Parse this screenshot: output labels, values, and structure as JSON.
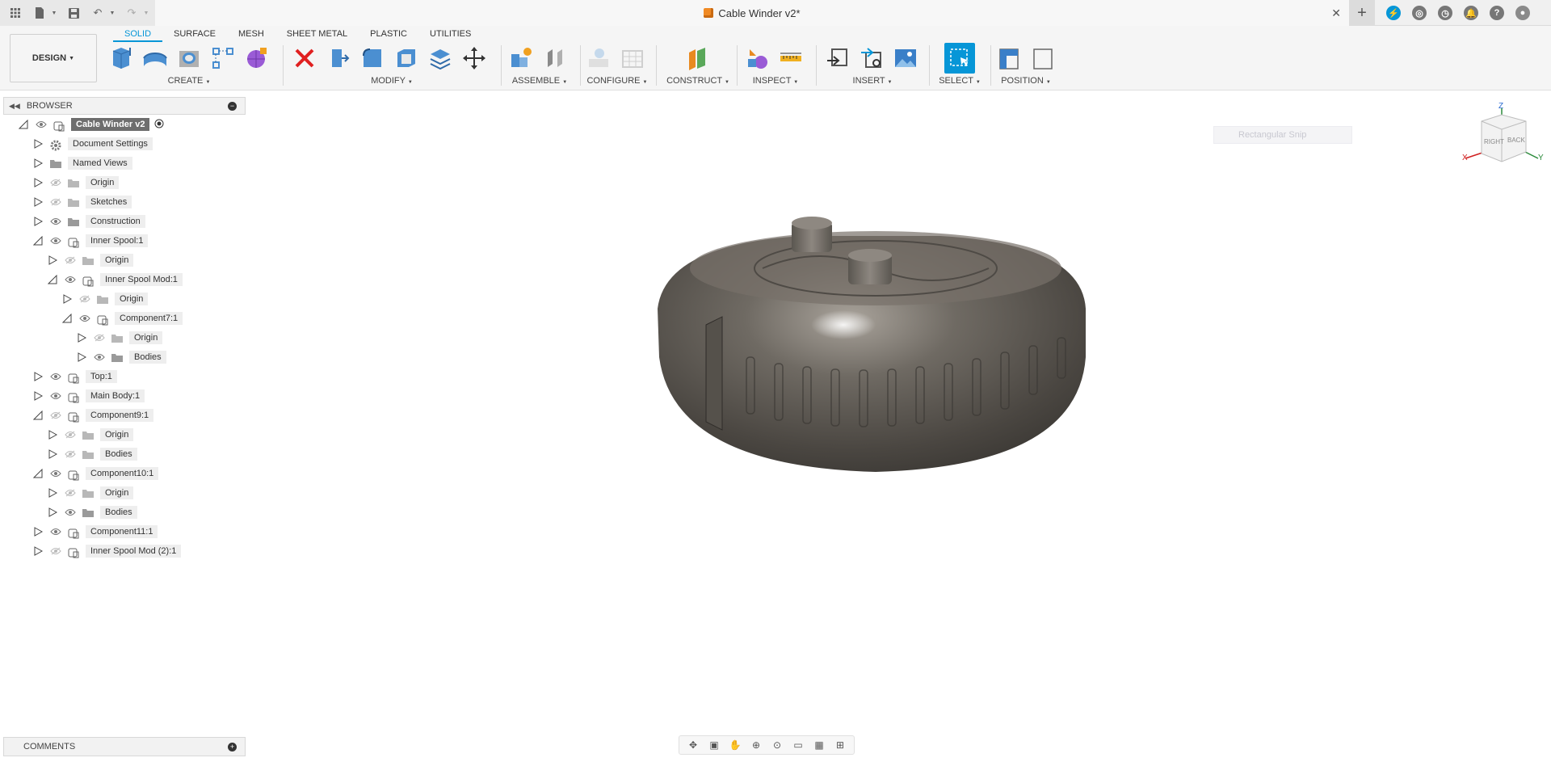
{
  "titlebar": {
    "document_title": "Cable Winder v2*"
  },
  "toolbar": {
    "workspace_label": "DESIGN",
    "tabs": [
      {
        "label": "SOLID",
        "active": true
      },
      {
        "label": "SURFACE",
        "active": false
      },
      {
        "label": "MESH",
        "active": false
      },
      {
        "label": "SHEET METAL",
        "active": false
      },
      {
        "label": "PLASTIC",
        "active": false
      },
      {
        "label": "UTILITIES",
        "active": false
      }
    ],
    "groups": {
      "create": "CREATE",
      "modify": "MODIFY",
      "assemble": "ASSEMBLE",
      "configure": "CONFIGURE",
      "construct": "CONSTRUCT",
      "inspect": "INSPECT",
      "insert": "INSERT",
      "select": "SELECT",
      "position": "POSITION"
    }
  },
  "browser": {
    "title": "BROWSER",
    "items": [
      {
        "label": "Cable Winder v2",
        "level": 0,
        "expanded": true,
        "root": true
      },
      {
        "label": "Document Settings",
        "level": 1,
        "expanded": false,
        "icon": "gear-icon"
      },
      {
        "label": "Named Views",
        "level": 1,
        "expanded": false,
        "icon": "folder-icon"
      },
      {
        "label": "Origin",
        "level": 1,
        "expanded": false,
        "icon": "folder-icon",
        "hidden": true
      },
      {
        "label": "Sketches",
        "level": 1,
        "expanded": false,
        "icon": "folder-icon",
        "hidden": true
      },
      {
        "label": "Construction",
        "level": 1,
        "expanded": false,
        "icon": "folder-icon"
      },
      {
        "label": "Inner Spool:1",
        "level": 1,
        "expanded": true,
        "icon": "component-icon"
      },
      {
        "label": "Origin",
        "level": 2,
        "expanded": false,
        "icon": "folder-icon",
        "hidden": true
      },
      {
        "label": "Inner Spool Mod:1",
        "level": 2,
        "expanded": true,
        "icon": "component-icon"
      },
      {
        "label": "Origin",
        "level": 3,
        "expanded": false,
        "icon": "folder-icon",
        "hidden": true
      },
      {
        "label": "Component7:1",
        "level": 3,
        "expanded": true,
        "icon": "component-icon"
      },
      {
        "label": "Origin",
        "level": 4,
        "expanded": false,
        "icon": "folder-icon",
        "hidden": true
      },
      {
        "label": "Bodies",
        "level": 4,
        "expanded": false,
        "icon": "folder-icon"
      },
      {
        "label": "Top:1",
        "level": 1,
        "expanded": false,
        "icon": "component-icon"
      },
      {
        "label": "Main Body:1",
        "level": 1,
        "expanded": false,
        "icon": "component-icon"
      },
      {
        "label": "Component9:1",
        "level": 1,
        "expanded": true,
        "icon": "component-icon",
        "hidden": true
      },
      {
        "label": "Origin",
        "level": 2,
        "expanded": false,
        "icon": "folder-icon",
        "hidden": true
      },
      {
        "label": "Bodies",
        "level": 2,
        "expanded": false,
        "icon": "folder-icon",
        "hidden": true
      },
      {
        "label": "Component10:1",
        "level": 1,
        "expanded": true,
        "icon": "component-icon"
      },
      {
        "label": "Origin",
        "level": 2,
        "expanded": false,
        "icon": "folder-icon",
        "hidden": true
      },
      {
        "label": "Bodies",
        "level": 2,
        "expanded": false,
        "icon": "folder-icon"
      },
      {
        "label": "Component11:1",
        "level": 1,
        "expanded": false,
        "icon": "component-icon"
      },
      {
        "label": "Inner Spool Mod (2):1",
        "level": 1,
        "expanded": false,
        "icon": "component-icon",
        "hidden": true
      }
    ]
  },
  "comments": {
    "title": "COMMENTS"
  },
  "viewport": {
    "snip_label": "Rectangular Snip",
    "viewcube": {
      "axis_z": "Z",
      "axis_x": "X",
      "axis_y": "Y",
      "face_right": "RIGHT",
      "face_back": "BACK"
    }
  },
  "colors": {
    "accent": "#0696d7",
    "model": "#6b6660",
    "title_icon": "#f08a24"
  }
}
